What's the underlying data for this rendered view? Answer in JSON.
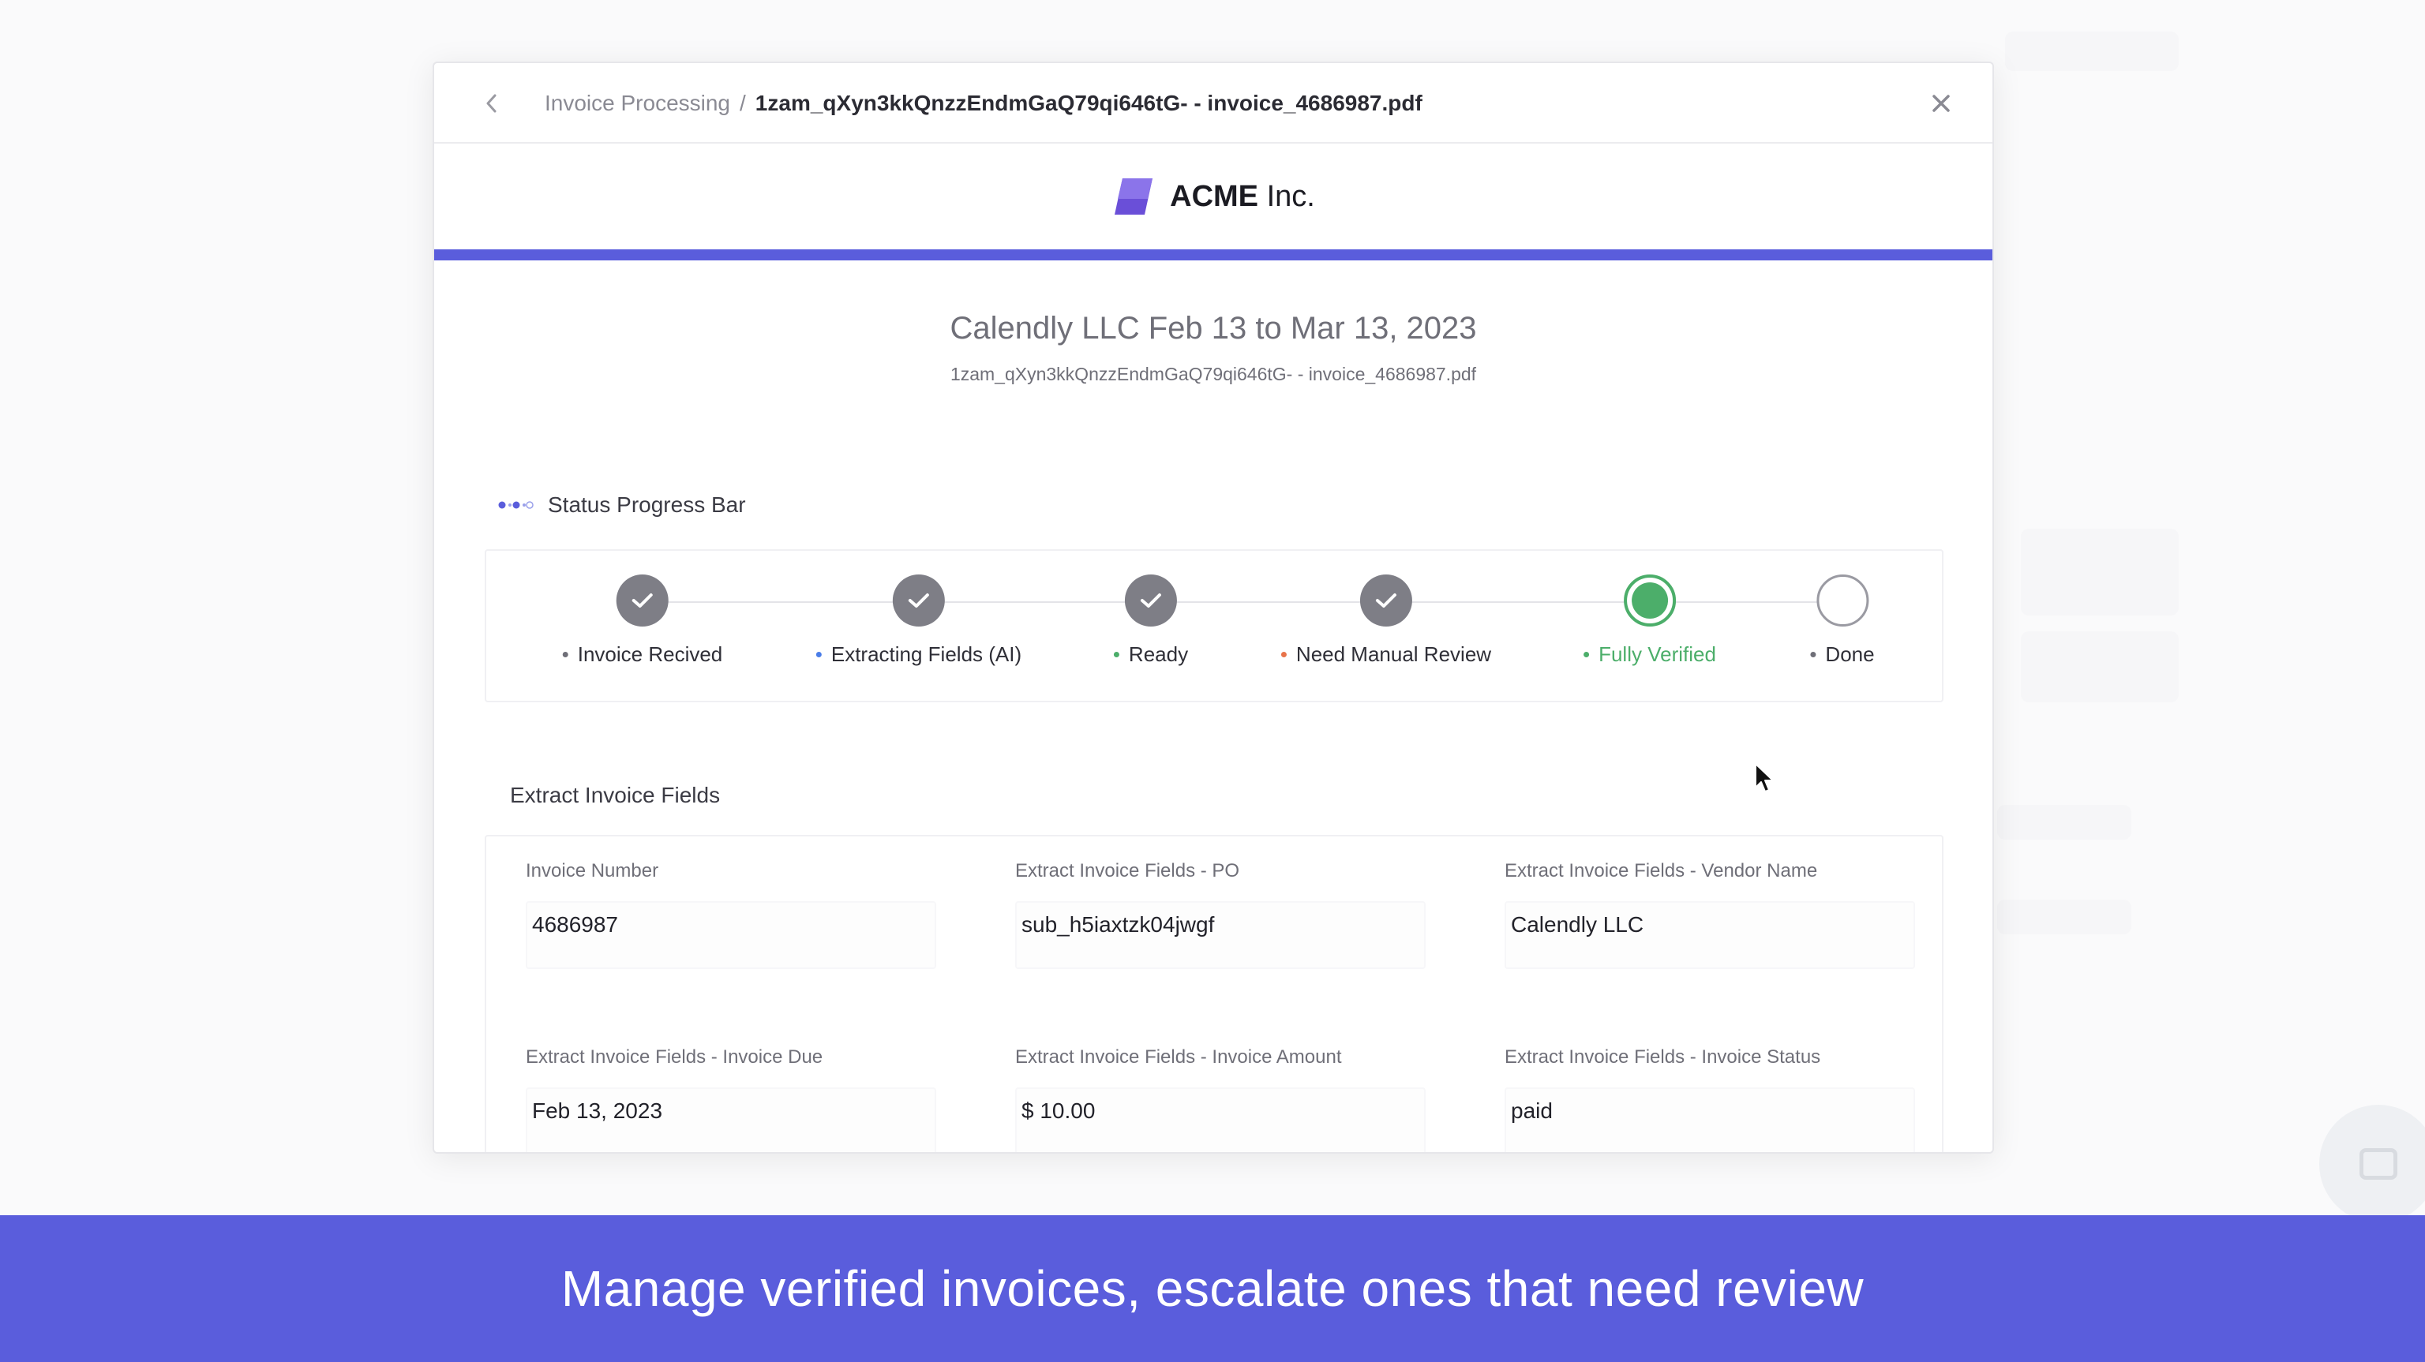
{
  "modal": {
    "breadcrumb": {
      "parent": "Invoice Processing",
      "separator": "/",
      "current": "1zam_qXyn3kkQnzzEndmGaQ79qi646tG- - invoice_4686987.pdf"
    },
    "brand": {
      "name_bold": "ACME",
      "name_rest": " Inc.",
      "logo_color": "#6a4fd8"
    },
    "accent_color": "#5a5ddc",
    "document": {
      "title": "Calendly LLC Feb 13 to Mar 13, 2023",
      "filename": "1zam_qXyn3kkQnzzEndmGaQ79qi646tG- - invoice_4686987.pdf"
    },
    "status": {
      "heading": "Status Progress Bar",
      "steps": [
        {
          "label": "Invoice Recived",
          "state": "done",
          "dot_color": "#6f6f78"
        },
        {
          "label": "Extracting Fields (AI)",
          "state": "done",
          "dot_color": "#4a7de8"
        },
        {
          "label": "Ready",
          "state": "done",
          "dot_color": "#4cae6a"
        },
        {
          "label": "Need Manual Review",
          "state": "done",
          "dot_color": "#e8734a"
        },
        {
          "label": "Fully Verified",
          "state": "active",
          "dot_color": "#4cae6a"
        },
        {
          "label": "Done",
          "state": "pending",
          "dot_color": "#6f6f78"
        }
      ]
    },
    "fields": {
      "heading": "Extract Invoice Fields",
      "items": [
        {
          "label": "Invoice Number",
          "value": "4686987"
        },
        {
          "label": "Extract Invoice Fields - PO",
          "value": "sub_h5iaxtzk04jwgf"
        },
        {
          "label": "Extract Invoice Fields - Vendor Name",
          "value": "Calendly LLC"
        },
        {
          "label": "Extract Invoice Fields - Invoice Due",
          "value": "Feb 13, 2023"
        },
        {
          "label": "Extract Invoice Fields - Invoice Amount",
          "value": "$ 10.00"
        },
        {
          "label": "Extract Invoice Fields - Invoice Status",
          "value": "paid"
        }
      ]
    }
  },
  "caption": {
    "text": "Manage verified invoices, escalate ones that need review",
    "background": "#5a5ddc"
  },
  "icons": {
    "back": "chevron-left-icon",
    "close": "close-icon",
    "status": "progress-dots-icon",
    "check": "checkmark-icon",
    "chat": "chat-icon"
  }
}
